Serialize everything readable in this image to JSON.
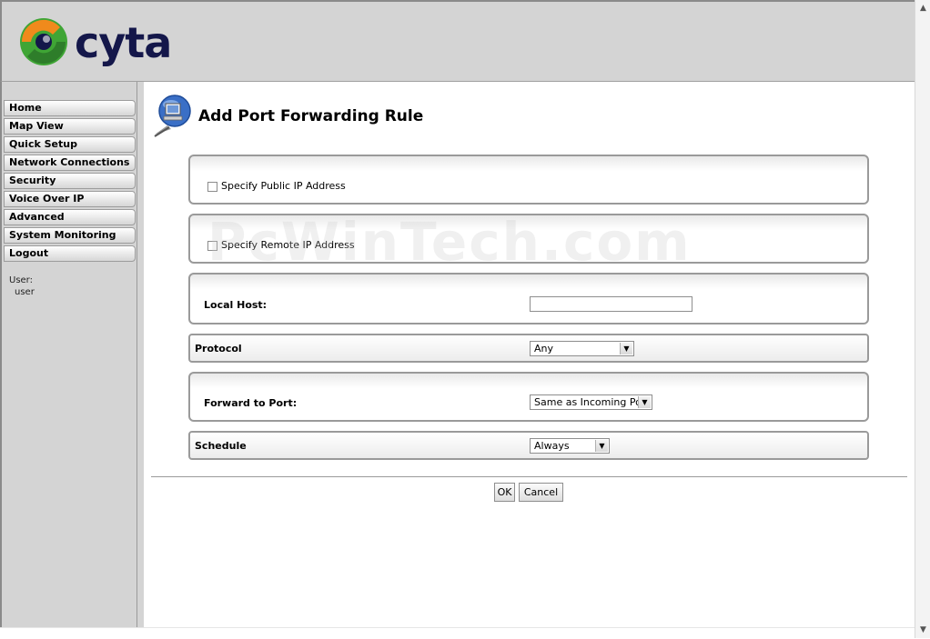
{
  "brand": {
    "logo_text": "cyta"
  },
  "sidebar": {
    "items": [
      {
        "label": "Home"
      },
      {
        "label": "Map View"
      },
      {
        "label": "Quick Setup"
      },
      {
        "label": "Network Connections"
      },
      {
        "label": "Security"
      },
      {
        "label": "Voice Over IP"
      },
      {
        "label": "Advanced"
      },
      {
        "label": "System Monitoring"
      },
      {
        "label": "Logout"
      }
    ],
    "user_label": "User:",
    "user_value": "user"
  },
  "main": {
    "title": "Add Port Forwarding Rule",
    "watermark": "PcWinTech.com",
    "public_ip": {
      "label": "Specify Public IP Address",
      "checked": false
    },
    "remote_ip": {
      "label": "Specify Remote IP Address",
      "checked": false
    },
    "local_host": {
      "label": "Local Host:",
      "value": ""
    },
    "protocol": {
      "label": "Protocol",
      "selected": "Any"
    },
    "forward_port": {
      "label": "Forward to Port:",
      "selected": "Same as Incoming Port"
    },
    "schedule": {
      "label": "Schedule",
      "selected": "Always"
    },
    "buttons": {
      "ok": "OK",
      "cancel": "Cancel"
    }
  },
  "colors": {
    "header_bg": "#d4d4d4",
    "logo_dark": "#14174a",
    "logo_green": "#3fa535",
    "logo_orange": "#f08a1c"
  },
  "icons": {
    "logo": "cyta-swirl-icon",
    "page": "network-computer-icon",
    "dropdown": "chevron-down-icon",
    "scroll_up": "scroll-up-arrow-icon",
    "scroll_down": "scroll-down-arrow-icon"
  }
}
